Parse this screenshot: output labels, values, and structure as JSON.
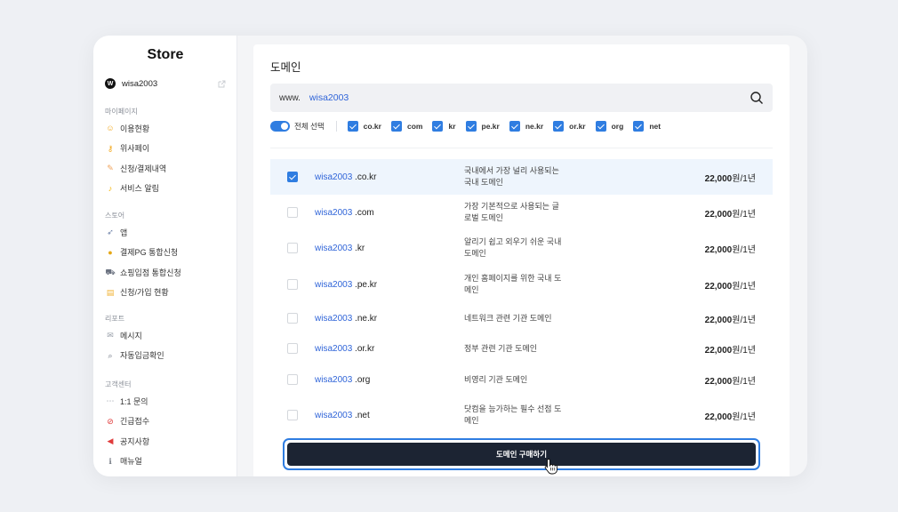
{
  "sidebar": {
    "title": "Store",
    "user": {
      "avatar": "W",
      "name": "wisa2003"
    },
    "sections": [
      {
        "label": "마이페이지",
        "items": [
          {
            "icon": "smile-icon",
            "glyph": "☺",
            "color": "#f2a81d",
            "label": "이용현황"
          },
          {
            "icon": "key-icon",
            "glyph": "⚷",
            "color": "#f2a81d",
            "label": "위사페이"
          },
          {
            "icon": "pencil-icon",
            "glyph": "✎",
            "color": "#f0a35b",
            "label": "신청/결제내역"
          },
          {
            "icon": "bell-icon",
            "glyph": "♪",
            "color": "#f5b400",
            "label": "서비스 알림"
          }
        ]
      },
      {
        "label": "스토어",
        "items": [
          {
            "icon": "rocket-icon",
            "glyph": "➶",
            "color": "#6b7fa6",
            "label": "앱"
          },
          {
            "icon": "money-bag-icon",
            "glyph": "●",
            "color": "#e6a817",
            "label": "결제PG 통합신청"
          },
          {
            "icon": "cart-icon",
            "glyph": "⛟",
            "color": "#6b7280",
            "label": "쇼핑입점 통합신청"
          },
          {
            "icon": "clipboard-icon",
            "glyph": "▤",
            "color": "#f2b233",
            "label": "신청/가입 현황"
          }
        ]
      },
      {
        "label": "리포트",
        "items": [
          {
            "icon": "mail-icon",
            "glyph": "✉",
            "color": "#9aa0aa",
            "label": "메시지"
          },
          {
            "icon": "magnifier-icon",
            "glyph": "⌕",
            "color": "#6b7280",
            "label": "자동입금확인"
          }
        ]
      },
      {
        "label": "고객센터",
        "items": [
          {
            "icon": "chat-icon",
            "glyph": "⋯",
            "color": "#9aa0aa",
            "label": "1:1 문의"
          },
          {
            "icon": "prohibited-icon",
            "glyph": "⊘",
            "color": "#e03b3b",
            "label": "긴급접수"
          },
          {
            "icon": "megaphone-icon",
            "glyph": "◀",
            "color": "#e03b3b",
            "label": "공지사항"
          },
          {
            "icon": "info-icon",
            "glyph": "ℹ",
            "color": "#7a7f88",
            "label": "매뉴얼"
          }
        ]
      }
    ]
  },
  "main": {
    "title": "도메인",
    "search": {
      "prefix": "www.",
      "value": "wisa2003",
      "placeholder": ""
    },
    "filters": {
      "all_label": "전체 선택",
      "tlds": [
        "co.kr",
        "com",
        "kr",
        "pe.kr",
        "ne.kr",
        "or.kr",
        "org",
        "net"
      ]
    },
    "domains": [
      {
        "name": "wisa2003",
        "tld": ".co.kr",
        "desc": "국내에서 가장 널리 사용되는 국내 도메인",
        "price": "22,000",
        "unit": "원/1년",
        "checked": true
      },
      {
        "name": "wisa2003",
        "tld": ".com",
        "desc": "가장 기본적으로 사용되는 글로벌 도메인",
        "price": "22,000",
        "unit": "원/1년",
        "checked": false
      },
      {
        "name": "wisa2003",
        "tld": ".kr",
        "desc": "알리기 쉽고 외우기 쉬운 국내 도메인",
        "price": "22,000",
        "unit": "원/1년",
        "checked": false
      },
      {
        "name": "wisa2003",
        "tld": ".pe.kr",
        "desc": "개인 홈페이지를 위한 국내 도메인",
        "price": "22,000",
        "unit": "원/1년",
        "checked": false
      },
      {
        "name": "wisa2003",
        "tld": ".ne.kr",
        "desc": "네트워크 관련 기관 도메인",
        "price": "22,000",
        "unit": "원/1년",
        "checked": false
      },
      {
        "name": "wisa2003",
        "tld": ".or.kr",
        "desc": "정부 관련 기관 도메인",
        "price": "22,000",
        "unit": "원/1년",
        "checked": false
      },
      {
        "name": "wisa2003",
        "tld": ".org",
        "desc": "비영리 기관 도메인",
        "price": "22,000",
        "unit": "원/1년",
        "checked": false
      },
      {
        "name": "wisa2003",
        "tld": ".net",
        "desc": "닷컴을 능가하는 필수 선점 도메인",
        "price": "22,000",
        "unit": "원/1년",
        "checked": false
      }
    ],
    "buy_label": "도메인 구매하기"
  },
  "colors": {
    "accent": "#2f7de1",
    "link": "#2f64d8",
    "button_bg": "#1c2433",
    "selected_row": "#eef5fd"
  }
}
